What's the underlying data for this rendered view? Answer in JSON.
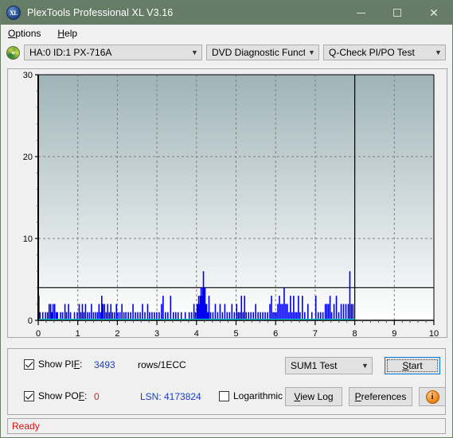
{
  "window": {
    "title": "PlexTools Professional XL V3.16",
    "app_icon": "XL",
    "minimize": "minimize-icon",
    "maximize": "maximize-icon",
    "close": "close-icon"
  },
  "menubar": {
    "items": [
      {
        "label": "Options"
      },
      {
        "label": "Help"
      }
    ]
  },
  "toolbar": {
    "drive_icon": "disc-icon",
    "drive": "HA:0 ID:1  PX-716A",
    "function": "DVD Diagnostic Functions",
    "test": "Q-Check PI/PO Test"
  },
  "controls": {
    "show_pif_label": "Show PIF:",
    "show_pif_value": "3493",
    "rows_label": "rows/1ECC",
    "show_pof_label": "Show POF:",
    "show_pof_value": "0",
    "lsn_label": "LSN:",
    "lsn_value": "4173824",
    "logarithmic_label": "Logarithmic",
    "test_select": "SUM1 Test",
    "start_button": "Start",
    "view_log_button": "View Log",
    "preferences_button": "Preferences",
    "info_button": "i"
  },
  "statusbar": {
    "text": "Ready"
  },
  "chart_data": {
    "type": "bar",
    "title": "",
    "xlabel": "",
    "ylabel": "",
    "xlim": [
      0,
      10
    ],
    "ylim": [
      0,
      30
    ],
    "xticks": [
      0,
      1,
      2,
      3,
      4,
      5,
      6,
      7,
      8,
      9,
      10
    ],
    "xticklabels": [
      "0",
      "1",
      "2",
      "3",
      "4",
      "5",
      "6",
      "7",
      "8",
      "9",
      "10"
    ],
    "yticks": [
      0,
      10,
      20,
      30
    ],
    "yticklabels": [
      "0",
      "10",
      "20",
      "30"
    ],
    "y_minor_tick_step": 2,
    "grid": true,
    "grid_style": "dashed",
    "legend": "none",
    "series_name": "PIF",
    "series_color": "#0000f0",
    "threshold_line": {
      "value": 4,
      "color": "#000000",
      "label": ""
    },
    "data_end_marker": {
      "value": 8,
      "color": "#000000"
    },
    "pof_baseline": {
      "value": 0,
      "color": "#00d8e8",
      "x_end": 8,
      "name": "POF"
    },
    "plot_bg_top": "#9fb4b8",
    "plot_bg_bottom": "#ffffff",
    "units": "rows/1ECC vs GB",
    "points": [
      [
        0.0,
        3.0
      ],
      [
        0.03,
        1.0
      ],
      [
        0.1,
        1.0
      ],
      [
        0.17,
        1.0
      ],
      [
        0.22,
        1.0
      ],
      [
        0.26,
        2.0
      ],
      [
        0.3,
        2.0
      ],
      [
        0.33,
        1.0
      ],
      [
        0.36,
        2.0
      ],
      [
        0.4,
        2.0
      ],
      [
        0.44,
        1.0
      ],
      [
        0.47,
        1.0
      ],
      [
        0.55,
        1.0
      ],
      [
        0.6,
        1.0
      ],
      [
        0.66,
        2.0
      ],
      [
        0.7,
        1.0
      ],
      [
        0.75,
        2.0
      ],
      [
        0.8,
        1.0
      ],
      [
        0.9,
        1.0
      ],
      [
        0.97,
        1.0
      ],
      [
        1.02,
        2.0
      ],
      [
        1.06,
        1.0
      ],
      [
        1.1,
        2.0
      ],
      [
        1.14,
        1.0
      ],
      [
        1.18,
        2.0
      ],
      [
        1.23,
        1.0
      ],
      [
        1.28,
        1.0
      ],
      [
        1.33,
        2.0
      ],
      [
        1.38,
        1.0
      ],
      [
        1.43,
        1.0
      ],
      [
        1.48,
        1.0
      ],
      [
        1.52,
        2.0
      ],
      [
        1.56,
        1.0
      ],
      [
        1.59,
        3.0
      ],
      [
        1.62,
        2.0
      ],
      [
        1.66,
        2.0
      ],
      [
        1.7,
        1.0
      ],
      [
        1.74,
        2.0
      ],
      [
        1.78,
        1.0
      ],
      [
        1.82,
        2.0
      ],
      [
        1.86,
        1.0
      ],
      [
        1.91,
        1.0
      ],
      [
        1.96,
        2.0
      ],
      [
        2.0,
        1.0
      ],
      [
        2.05,
        1.0
      ],
      [
        2.1,
        2.0
      ],
      [
        2.15,
        1.0
      ],
      [
        2.2,
        1.0
      ],
      [
        2.26,
        1.0
      ],
      [
        2.32,
        1.0
      ],
      [
        2.38,
        2.0
      ],
      [
        2.44,
        1.0
      ],
      [
        2.5,
        1.0
      ],
      [
        2.56,
        1.0
      ],
      [
        2.62,
        2.0
      ],
      [
        2.68,
        1.0
      ],
      [
        2.75,
        2.0
      ],
      [
        2.8,
        1.0
      ],
      [
        2.86,
        1.0
      ],
      [
        2.92,
        1.0
      ],
      [
        2.98,
        1.0
      ],
      [
        3.04,
        1.0
      ],
      [
        3.1,
        2.0
      ],
      [
        3.14,
        3.0
      ],
      [
        3.2,
        1.0
      ],
      [
        3.26,
        1.0
      ],
      [
        3.33,
        3.0
      ],
      [
        3.4,
        1.0
      ],
      [
        3.46,
        1.0
      ],
      [
        3.52,
        1.0
      ],
      [
        3.6,
        1.0
      ],
      [
        3.7,
        1.0
      ],
      [
        3.8,
        1.0
      ],
      [
        3.86,
        1.0
      ],
      [
        3.92,
        2.0
      ],
      [
        3.96,
        1.0
      ],
      [
        4.0,
        2.0
      ],
      [
        4.02,
        2.0
      ],
      [
        4.04,
        3.0
      ],
      [
        4.06,
        2.0
      ],
      [
        4.08,
        3.0
      ],
      [
        4.1,
        4.0
      ],
      [
        4.12,
        3.0
      ],
      [
        4.14,
        4.0
      ],
      [
        4.16,
        6.0
      ],
      [
        4.17,
        3.0
      ],
      [
        4.18,
        4.0
      ],
      [
        4.19,
        2.0
      ],
      [
        4.2,
        4.0
      ],
      [
        4.21,
        2.0
      ],
      [
        4.22,
        2.0
      ],
      [
        4.23,
        2.0
      ],
      [
        4.24,
        2.0
      ],
      [
        4.26,
        1.0
      ],
      [
        4.28,
        1.0
      ],
      [
        4.3,
        3.0
      ],
      [
        4.34,
        1.0
      ],
      [
        4.4,
        1.0
      ],
      [
        4.46,
        2.0
      ],
      [
        4.52,
        1.0
      ],
      [
        4.58,
        2.0
      ],
      [
        4.64,
        1.0
      ],
      [
        4.7,
        2.0
      ],
      [
        4.76,
        1.0
      ],
      [
        4.82,
        1.0
      ],
      [
        4.88,
        2.0
      ],
      [
        4.94,
        1.0
      ],
      [
        5.0,
        2.0
      ],
      [
        5.04,
        1.0
      ],
      [
        5.08,
        1.0
      ],
      [
        5.12,
        3.0
      ],
      [
        5.16,
        1.0
      ],
      [
        5.2,
        3.0
      ],
      [
        5.24,
        1.0
      ],
      [
        5.3,
        1.0
      ],
      [
        5.36,
        1.0
      ],
      [
        5.42,
        1.0
      ],
      [
        5.48,
        2.0
      ],
      [
        5.54,
        1.0
      ],
      [
        5.6,
        1.0
      ],
      [
        5.66,
        1.0
      ],
      [
        5.72,
        1.0
      ],
      [
        5.78,
        1.0
      ],
      [
        5.84,
        2.0
      ],
      [
        5.88,
        3.0
      ],
      [
        5.92,
        1.0
      ],
      [
        5.96,
        1.0
      ],
      [
        6.0,
        1.0
      ],
      [
        6.04,
        2.0
      ],
      [
        6.08,
        3.0
      ],
      [
        6.12,
        2.0
      ],
      [
        6.16,
        2.0
      ],
      [
        6.2,
        4.0
      ],
      [
        6.24,
        2.0
      ],
      [
        6.28,
        2.0
      ],
      [
        6.32,
        1.0
      ],
      [
        6.36,
        3.0
      ],
      [
        6.4,
        1.0
      ],
      [
        6.44,
        3.0
      ],
      [
        6.48,
        1.0
      ],
      [
        6.52,
        1.0
      ],
      [
        6.56,
        3.0
      ],
      [
        6.6,
        1.0
      ],
      [
        6.66,
        3.0
      ],
      [
        6.72,
        1.0
      ],
      [
        6.8,
        2.0
      ],
      [
        6.9,
        1.0
      ],
      [
        7.0,
        3.0
      ],
      [
        7.06,
        1.0
      ],
      [
        7.12,
        1.0
      ],
      [
        7.18,
        1.0
      ],
      [
        7.24,
        2.0
      ],
      [
        7.28,
        2.0
      ],
      [
        7.32,
        2.0
      ],
      [
        7.36,
        3.0
      ],
      [
        7.4,
        1.0
      ],
      [
        7.46,
        2.0
      ],
      [
        7.52,
        3.0
      ],
      [
        7.58,
        1.0
      ],
      [
        7.64,
        2.0
      ],
      [
        7.7,
        2.0
      ],
      [
        7.76,
        2.0
      ],
      [
        7.82,
        2.0
      ],
      [
        7.86,
        6.0
      ],
      [
        7.9,
        2.0
      ],
      [
        7.94,
        2.0
      ]
    ]
  }
}
